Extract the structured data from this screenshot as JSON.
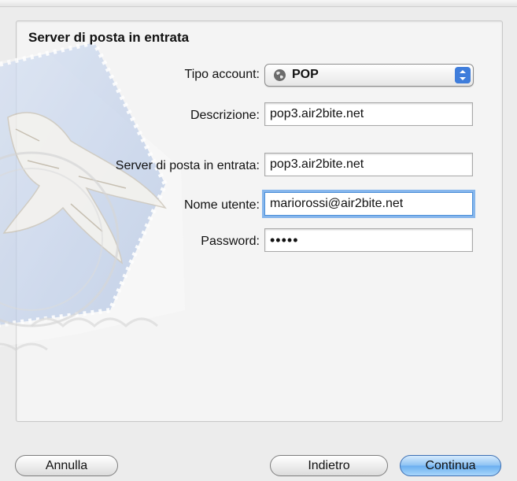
{
  "section": {
    "title": "Server di posta in entrata"
  },
  "form": {
    "account_type": {
      "label": "Tipo account:",
      "value": "POP",
      "icon": "globe-icon"
    },
    "description": {
      "label": "Descrizione:",
      "value": "pop3.air2bite.net"
    },
    "incoming_server": {
      "label": "Server di posta in entrata:",
      "value": "pop3.air2bite.net"
    },
    "username": {
      "label": "Nome utente:",
      "value": "mariorossi@air2bite.net"
    },
    "password": {
      "label": "Password:",
      "value": "•••••"
    }
  },
  "buttons": {
    "cancel": "Annulla",
    "back": "Indietro",
    "continue": "Continua"
  },
  "colors": {
    "focus_ring": "#86b6ec",
    "default_button": "#8cc2f3",
    "stamp": "#b9c9e6"
  }
}
